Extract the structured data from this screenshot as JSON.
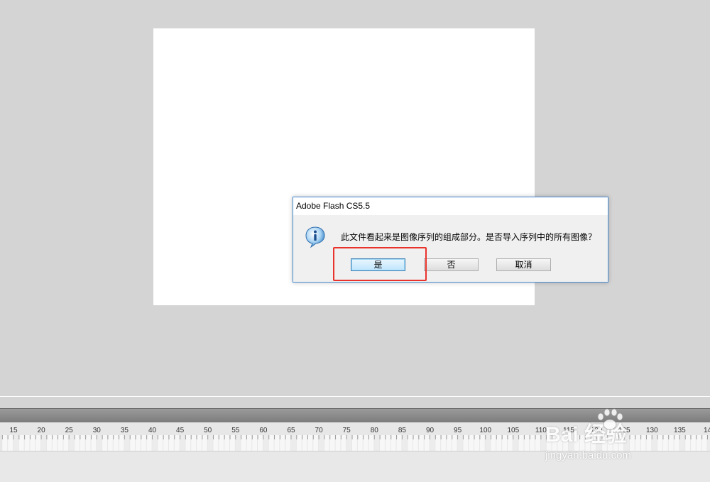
{
  "dialog": {
    "title": "Adobe Flash CS5.5",
    "message": "此文件看起来是图像序列的组成部分。是否导入序列中的所有图像？",
    "icon": "info-icon",
    "buttons": {
      "yes": "是",
      "no": "否",
      "cancel": "取消"
    }
  },
  "timeline": {
    "ruler_labels": [
      "15",
      "20",
      "25",
      "30",
      "35",
      "40",
      "45",
      "50",
      "55",
      "60",
      "65",
      "70",
      "75",
      "80",
      "85",
      "90",
      "95",
      "100",
      "105",
      "110",
      "115",
      "120",
      "125",
      "130",
      "135",
      "14"
    ]
  },
  "watermark": {
    "logo": "Bai 经验",
    "url": "jingyan.baidu.com"
  },
  "colors": {
    "highlight": "#e8322b",
    "dialog_border": "#4b8cd0",
    "workspace": "#d4d4d4"
  }
}
